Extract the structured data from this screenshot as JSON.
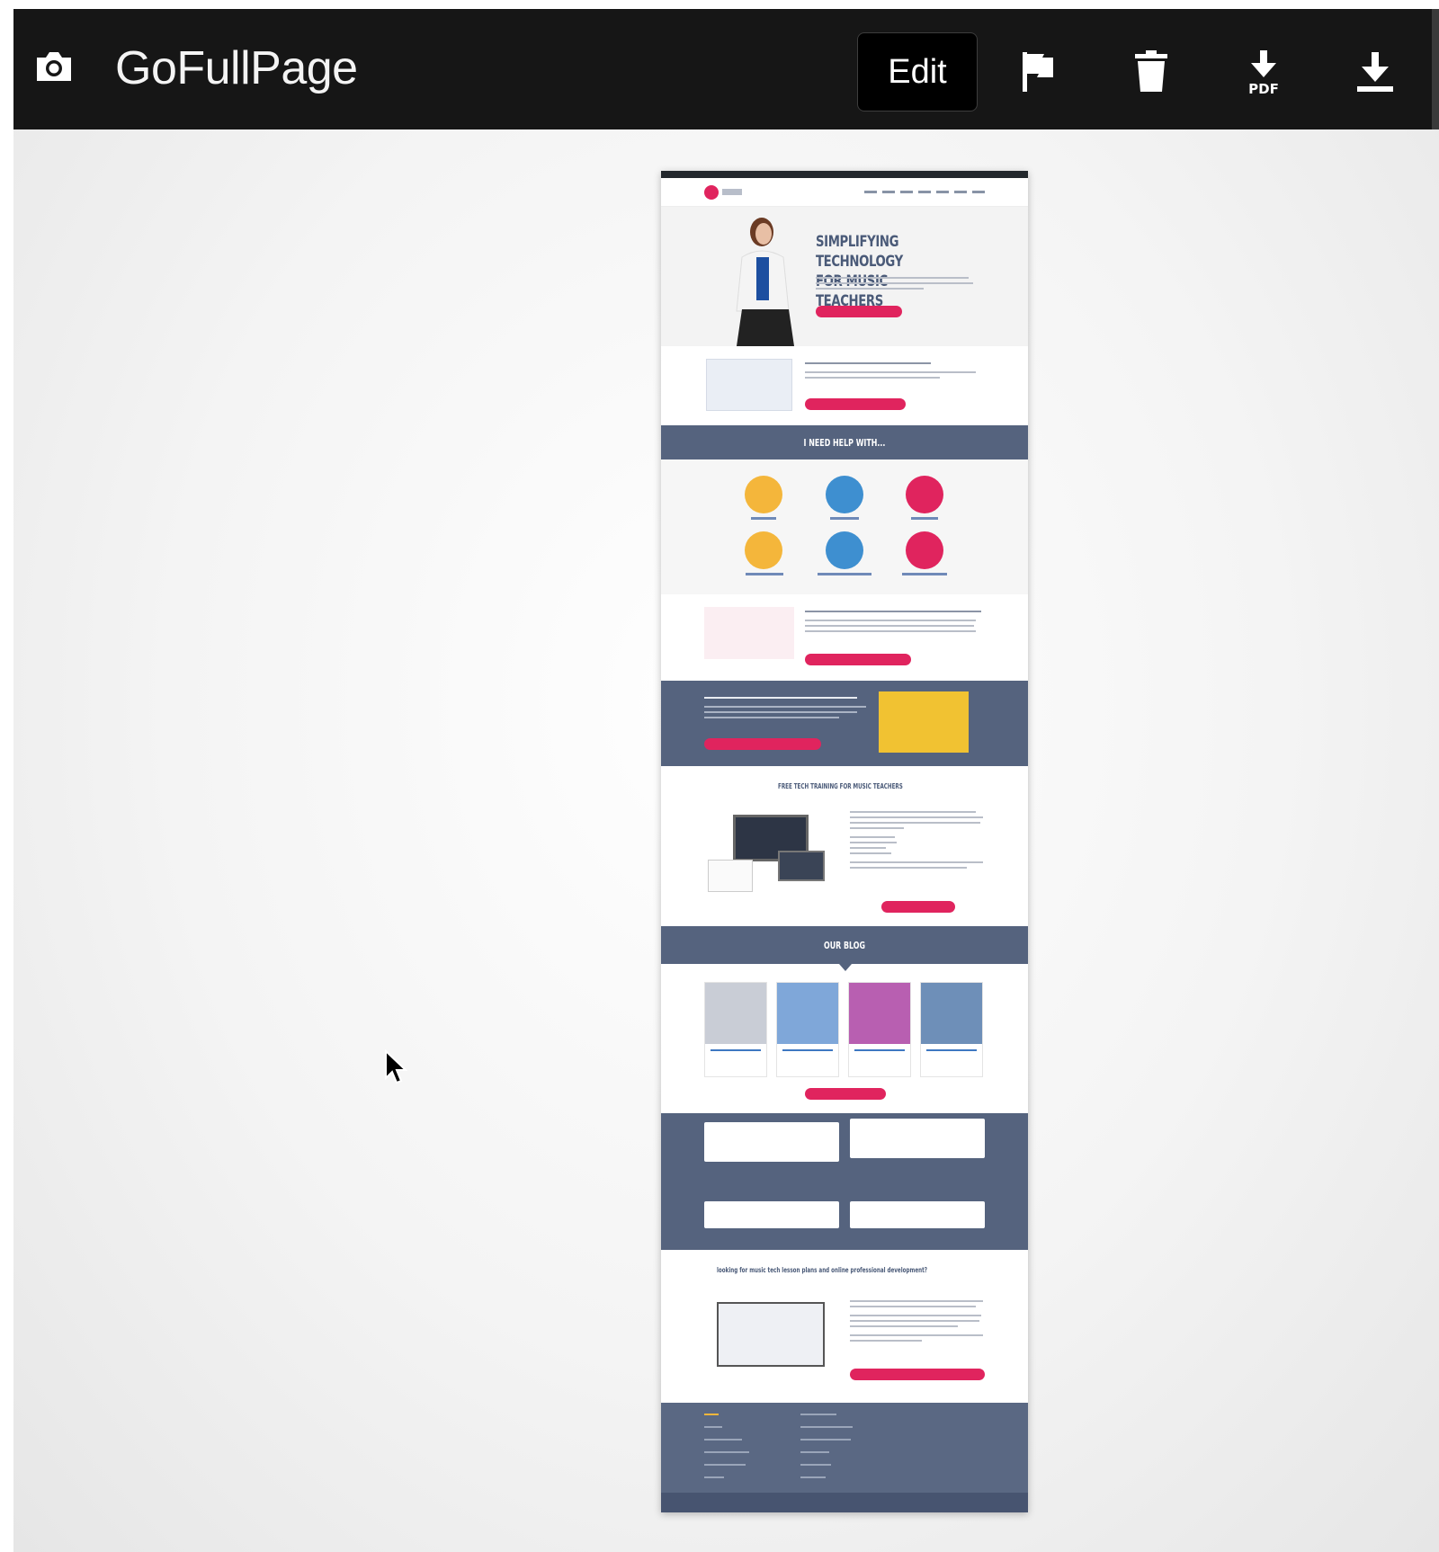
{
  "app": {
    "title": "GoFullPage",
    "edit_label": "Edit",
    "icons": [
      "camera-icon",
      "flag-icon",
      "trash-icon",
      "download-pdf-icon",
      "download-icon"
    ],
    "pdf_label": "PDF"
  },
  "preview": {
    "hero_title_line1": "SIMPLIFYING TECHNOLOGY",
    "hero_title_line2": "FOR MUSIC TEACHERS",
    "help_heading": "I NEED HELP WITH...",
    "free_training_heading": "FREE TECH TRAINING FOR MUSIC TEACHERS",
    "blog_heading": "OUR BLOG",
    "community_heading": "looking for music tech lesson plans and online professional development?"
  },
  "colors": {
    "topbar": "#161616",
    "accent": "#e0245e",
    "band": "#55637e"
  }
}
